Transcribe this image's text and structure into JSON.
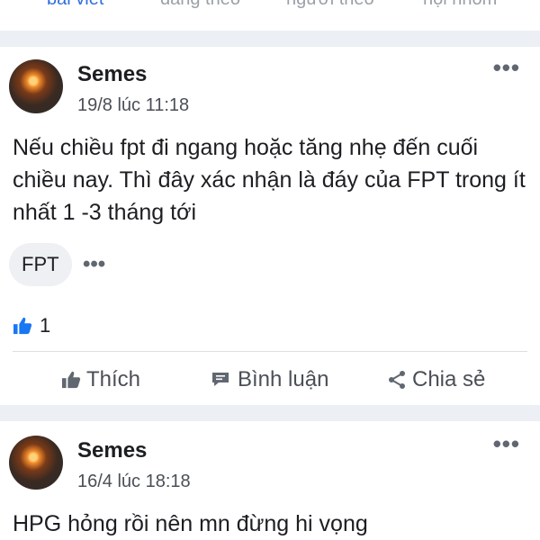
{
  "tabs": [
    {
      "label": "bài viết",
      "active": true
    },
    {
      "label": "đang theo",
      "active": false
    },
    {
      "label": "người theo",
      "active": false
    },
    {
      "label": "hội nhóm",
      "active": false
    }
  ],
  "colors": {
    "accent": "#2f6fdc",
    "like_blue": "#1877f2",
    "separator": "#eceff3"
  },
  "posts": [
    {
      "author": "Semes",
      "time": "19/8 lúc 11:18",
      "text": "Nếu chiều fpt đi ngang hoặc tăng nhẹ đến cuối chiều nay. Thì đây xác nhận là đáy của FPT trong ít nhất 1 -3 tháng tới",
      "tag": "FPT",
      "like_count": "1",
      "actions": {
        "like": "Thích",
        "comment": "Bình luận",
        "share": "Chia sẻ"
      }
    },
    {
      "author": "Semes",
      "time": "16/4 lúc 18:18",
      "text": "HPG hỏng rồi nên mn đừng hi vọng"
    }
  ],
  "icons": {
    "more": "more-horizontal-icon",
    "like": "thumbs-up-icon",
    "comment": "comment-icon",
    "share": "share-icon"
  }
}
